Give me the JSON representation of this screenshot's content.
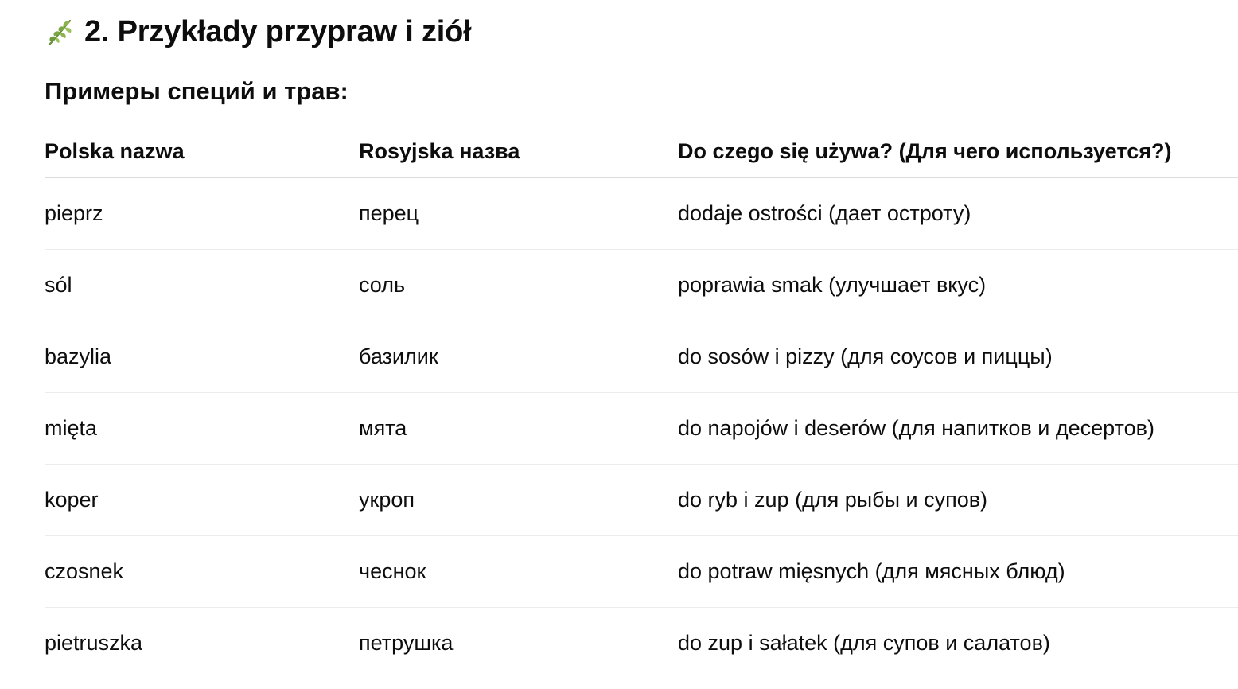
{
  "section": {
    "icon": "herb-leaf-icon",
    "title": "2. Przykłady przypraw i ziół"
  },
  "subheading": "Примеры специй и трав:",
  "table": {
    "headers": [
      "Polska nazwa",
      "Rosyjska назва",
      "Do czego się używa? (Для чего используется?)"
    ],
    "rows": [
      [
        "pieprz",
        "перец",
        "dodaje ostrości (дает остроту)"
      ],
      [
        "sól",
        "соль",
        "poprawia smak (улучшает вкус)"
      ],
      [
        "bazylia",
        "базилик",
        "do sosów i pizzy (для соусов и пиццы)"
      ],
      [
        "mięta",
        "мята",
        "do napojów i deserów (для напитков и десертов)"
      ],
      [
        "koper",
        "укроп",
        "do ryb i zup (для рыбы и супов)"
      ],
      [
        "czosnek",
        "чеснок",
        "do potraw mięsnych (для мясных блюд)"
      ],
      [
        "pietruszka",
        "петрушка",
        "do zup i sałatek (для супов и салатов)"
      ]
    ]
  }
}
